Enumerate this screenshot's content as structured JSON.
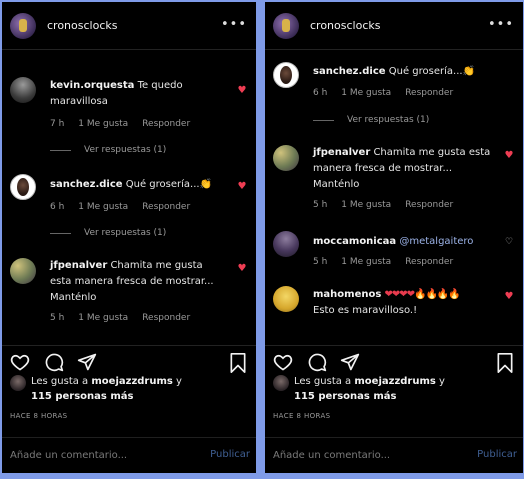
{
  "left": {
    "header": {
      "username": "cronosclocks",
      "more": "•••"
    },
    "comments": [
      {
        "user": "kevin.orquesta",
        "text": "Te quedo maravillosa",
        "time": "7 h",
        "likes": "1 Me gusta",
        "reply": "Responder",
        "view_replies": "Ver respuestas (1)"
      },
      {
        "user": "sanchez.dice",
        "text": "Qué grosería...👏",
        "time": "6 h",
        "likes": "1 Me gusta",
        "reply": "Responder",
        "view_replies": "Ver respuestas (1)"
      },
      {
        "user": "jfpenalver",
        "text": "Chamita me gusta esta manera fresca de mostrar... Manténlo",
        "time": "5 h",
        "likes": "1 Me gusta",
        "reply": "Responder"
      }
    ],
    "likes": {
      "prefix": "Les gusta a",
      "user": "moejazzdrums",
      "suffix": "y",
      "others": "115 personas más"
    },
    "time_ago": "HACE 8 HORAS",
    "comment_placeholder": "Añade un comentario...",
    "publish": "Publicar"
  },
  "right": {
    "header": {
      "username": "cronosclocks",
      "more": "•••"
    },
    "comments": [
      {
        "user": "sanchez.dice",
        "text": "Qué grosería...👏",
        "time": "6 h",
        "likes": "1 Me gusta",
        "reply": "Responder",
        "view_replies": "Ver respuestas (1)"
      },
      {
        "user": "jfpenalver",
        "text": "Chamita me gusta esta manera fresca de mostrar... Manténlo",
        "time": "5 h",
        "likes": "1 Me gusta",
        "reply": "Responder"
      },
      {
        "user": "moccamonicaa",
        "mention": "@metalgaitero",
        "time": "5 h",
        "likes": "1 Me gusta",
        "reply": "Responder"
      },
      {
        "user": "mahomenos",
        "hearts": "❤❤❤❤🔥🔥🔥🔥",
        "text2": "Esto es maravilloso.!"
      }
    ],
    "likes": {
      "prefix": "Les gusta a",
      "user": "moejazzdrums",
      "suffix": "y",
      "others": "115 personas más"
    },
    "time_ago": "HACE 8 HORAS",
    "comment_placeholder": "Añade un comentario...",
    "publish": "Publicar"
  },
  "colors": {
    "like_red": "#ee3d53",
    "mention_blue": "#9cb3e8",
    "publish_blue": "#3f5f93",
    "background": "#000000",
    "frame": "#7f9be8"
  },
  "icons": [
    "more-icon",
    "heart-icon",
    "comment-icon",
    "share-icon",
    "bookmark-icon"
  ]
}
